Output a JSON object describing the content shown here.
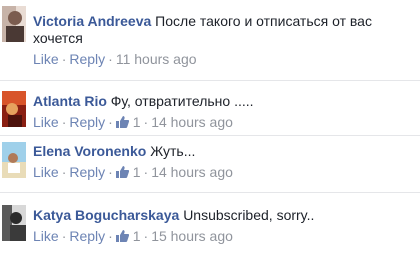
{
  "actions": {
    "like_label": "Like",
    "reply_label": "Reply",
    "separator": "·"
  },
  "comments": [
    {
      "author": "Victoria Andreeva",
      "text": "После такого и отписаться от вас",
      "text_cont": "хочется",
      "likes": "",
      "time": "11 hours ago"
    },
    {
      "author": "Atlanta Rio",
      "text": "Фу, отвратительно .....",
      "likes": "1",
      "time": "14 hours ago"
    },
    {
      "author": "Elena Voronenko",
      "text": "Жуть...",
      "likes": "1",
      "time": "14 hours ago"
    },
    {
      "author": "Katya Bogucharskaya",
      "text": "Unsubscribed, sorry..",
      "likes": "1",
      "time": "15 hours ago"
    }
  ],
  "colors": {
    "author_link": "#3b5998",
    "action_link": "#6d84b4",
    "meta": "#90949c",
    "text": "#1d2129"
  }
}
